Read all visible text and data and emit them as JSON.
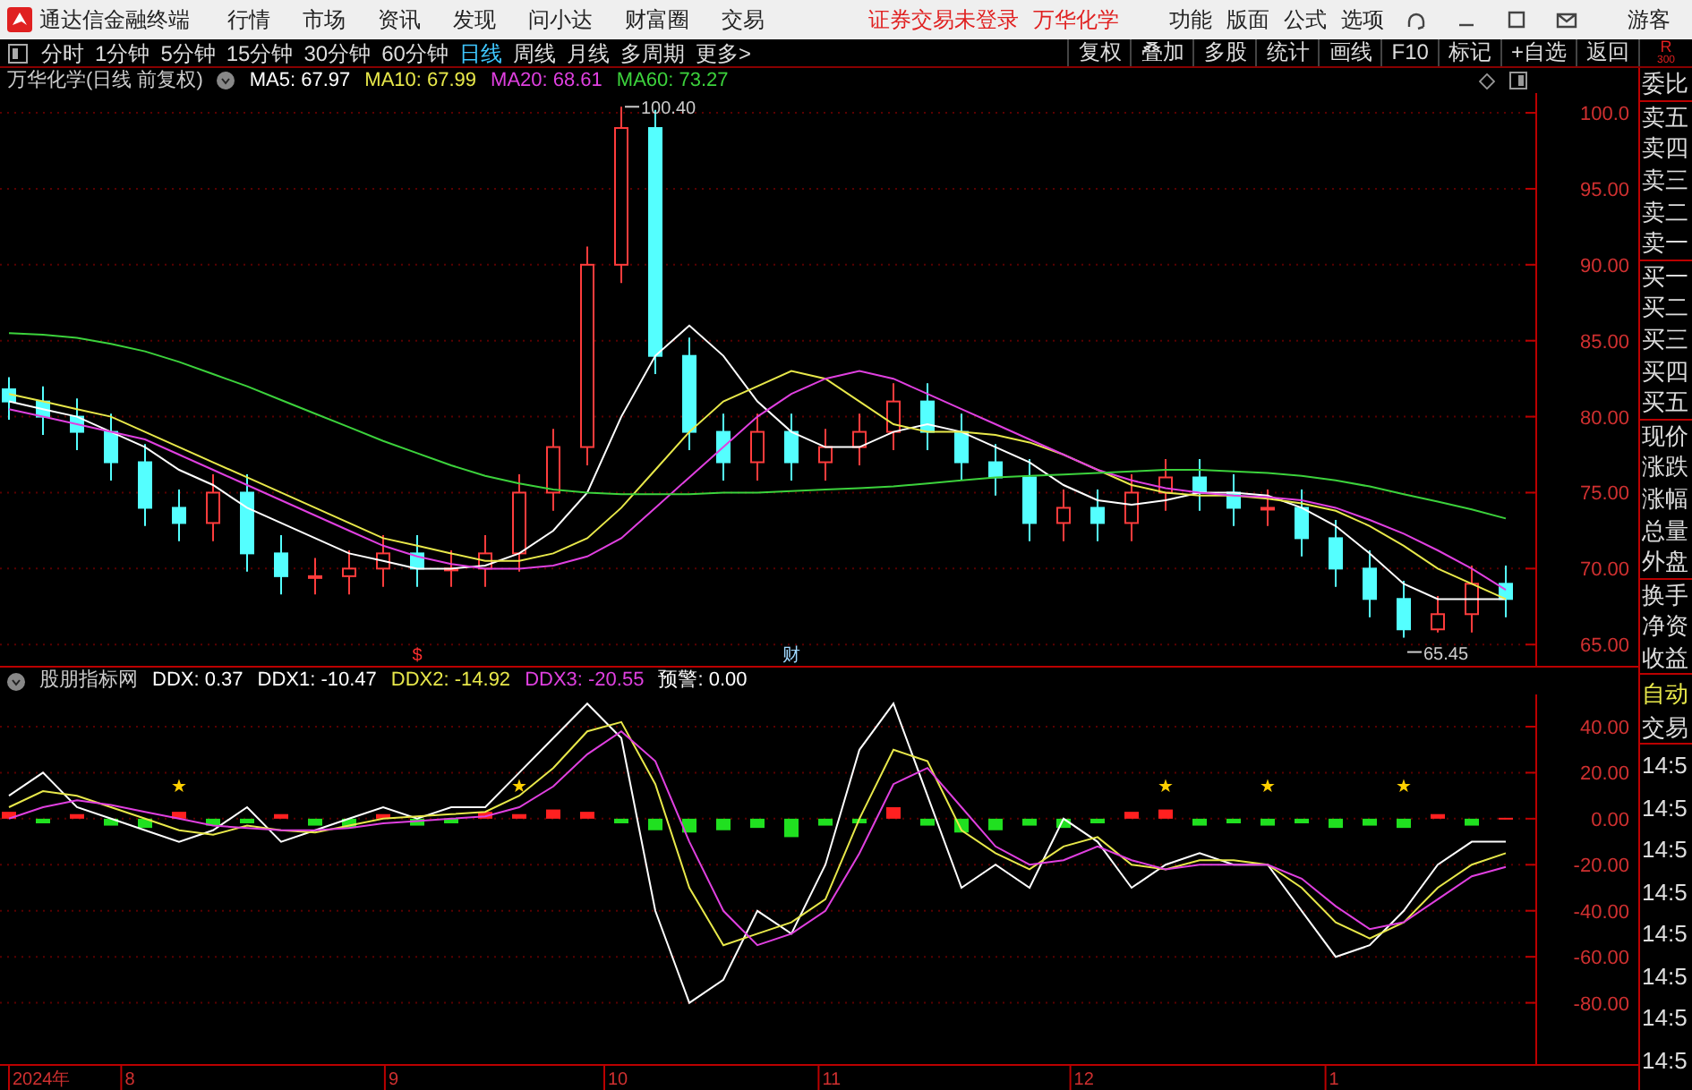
{
  "app_bar": {
    "title": "通达信金融终端",
    "menu": [
      "行情",
      "市场",
      "资讯",
      "发现",
      "问小达",
      "财富圈",
      "交易"
    ],
    "notices": [
      "证券交易未登录",
      "万华化学"
    ],
    "actions": [
      "功能",
      "版面",
      "公式",
      "选项"
    ],
    "user": "游客"
  },
  "toolbar": {
    "periods": [
      {
        "label": "分时",
        "selected": false
      },
      {
        "label": "1分钟",
        "selected": false
      },
      {
        "label": "5分钟",
        "selected": false
      },
      {
        "label": "15分钟",
        "selected": false
      },
      {
        "label": "30分钟",
        "selected": false
      },
      {
        "label": "60分钟",
        "selected": false
      },
      {
        "label": "日线",
        "selected": true
      },
      {
        "label": "周线",
        "selected": false
      },
      {
        "label": "月线",
        "selected": false
      },
      {
        "label": "多周期",
        "selected": false
      },
      {
        "label": "更多>",
        "selected": false
      }
    ],
    "tools": [
      "复权",
      "叠加",
      "多股",
      "统计",
      "画线",
      "F10",
      "标记",
      "+自选",
      "返回"
    ],
    "corner": [
      "R",
      "300"
    ]
  },
  "price_panel": {
    "title": "万华化学(日线 前复权)",
    "legend": [
      {
        "text": "MA5: 67.97",
        "color": "#ffffff"
      },
      {
        "text": "MA10: 67.99",
        "color": "#e8e84a"
      },
      {
        "text": "MA20: 68.61",
        "color": "#e040e0"
      },
      {
        "text": "MA60: 73.27",
        "color": "#3cd23c"
      }
    ],
    "chart_data": {
      "type": "candlestick",
      "grid": true,
      "ylim": [
        63.6,
        101.3
      ],
      "yticks": [
        {
          "value": 100,
          "label": "100.0"
        },
        {
          "value": 95,
          "label": "95.00"
        },
        {
          "value": 90,
          "label": "90.00"
        },
        {
          "value": 85,
          "label": "85.00"
        },
        {
          "value": 80,
          "label": "80.00"
        },
        {
          "value": 75,
          "label": "75.00"
        },
        {
          "value": 70,
          "label": "70.00"
        },
        {
          "value": 65,
          "label": "65.00"
        }
      ],
      "ohlc": [
        [
          81.8,
          82.6,
          79.8,
          81
        ],
        [
          81,
          82,
          78.8,
          80
        ],
        [
          80,
          81.2,
          77.8,
          79
        ],
        [
          79,
          80.2,
          75.8,
          77
        ],
        [
          77,
          78.2,
          72.8,
          74
        ],
        [
          74,
          75.2,
          71.8,
          73
        ],
        [
          73,
          76.2,
          71.8,
          75
        ],
        [
          75,
          76.2,
          69.8,
          71
        ],
        [
          71,
          72.2,
          68.3,
          69.5
        ],
        [
          69.5,
          70.7,
          68.3,
          69.5
        ],
        [
          69.5,
          71.2,
          68.3,
          70
        ],
        [
          70,
          72.2,
          68.8,
          71
        ],
        [
          71,
          72.2,
          68.8,
          70
        ],
        [
          70,
          71.2,
          68.8,
          70
        ],
        [
          70,
          72.2,
          68.8,
          71
        ],
        [
          71,
          76.2,
          69.8,
          75
        ],
        [
          75,
          79.2,
          73.8,
          78
        ],
        [
          78,
          91.2,
          76.8,
          90
        ],
        [
          90,
          100.4,
          88.8,
          99
        ],
        [
          99,
          100.2,
          82.8,
          84
        ],
        [
          84,
          85.2,
          77.8,
          79
        ],
        [
          79,
          80.2,
          75.8,
          77
        ],
        [
          77,
          80.2,
          75.8,
          79
        ],
        [
          79,
          80.2,
          75.8,
          77
        ],
        [
          77,
          79.2,
          75.8,
          78
        ],
        [
          78,
          80.2,
          76.8,
          79
        ],
        [
          79,
          82.2,
          77.8,
          81
        ],
        [
          81,
          82.2,
          77.8,
          79
        ],
        [
          79,
          80.2,
          75.8,
          77
        ],
        [
          77,
          78.2,
          74.8,
          76
        ],
        [
          76,
          77.2,
          71.8,
          73
        ],
        [
          73,
          75.2,
          71.8,
          74
        ],
        [
          74,
          75.2,
          71.8,
          73
        ],
        [
          73,
          76.2,
          71.8,
          75
        ],
        [
          75,
          77.2,
          73.8,
          76
        ],
        [
          76,
          77.2,
          73.8,
          75
        ],
        [
          75,
          76.2,
          72.8,
          74
        ],
        [
          74,
          75.2,
          72.8,
          74
        ],
        [
          74,
          75.2,
          70.8,
          72
        ],
        [
          72,
          73.2,
          68.8,
          70
        ],
        [
          70,
          71.2,
          66.8,
          68
        ],
        [
          68,
          69.2,
          65.45,
          66
        ],
        [
          66,
          68.2,
          65.8,
          67
        ],
        [
          67,
          70.2,
          65.8,
          69
        ],
        [
          69,
          70.2,
          66.8,
          68
        ]
      ],
      "annotations": [
        "100.40",
        "65.45"
      ]
    },
    "moving_averages": {
      "chart_data": {
        "type": "line",
        "ylim": [
          63.6,
          101.3
        ],
        "series": [
          {
            "color": "#ffffff",
            "values": [
              81,
              80.5,
              80,
              79,
              78,
              76.5,
              75.5,
              74,
              73,
              72,
              71,
              70.5,
              70,
              70,
              70.2,
              71,
              72.5,
              75,
              80,
              84,
              86,
              84,
              81,
              79,
              78,
              78,
              79,
              79.5,
              79,
              78,
              77,
              75.5,
              74.5,
              74.2,
              74.5,
              75,
              75,
              74.8,
              74,
              72.8,
              71,
              69,
              68,
              68,
              68
            ]
          },
          {
            "color": "#e8e84a",
            "values": [
              81.5,
              81,
              80.5,
              80,
              79,
              78,
              77,
              76,
              75,
              74,
              73,
              72,
              71.5,
              71,
              70.5,
              70.5,
              71,
              72,
              74,
              76.5,
              79,
              81,
              82,
              83,
              82.5,
              81,
              79.5,
              79,
              79,
              78.8,
              78.3,
              77.5,
              76.5,
              75.5,
              75,
              74.8,
              74.8,
              74.6,
              74.3,
              73.8,
              72.8,
              71.5,
              70,
              69,
              68
            ]
          },
          {
            "color": "#e040e0",
            "values": [
              80.5,
              80,
              79.5,
              79,
              78.5,
              77.5,
              76.5,
              75.5,
              74.5,
              73.5,
              72.5,
              71.5,
              70.8,
              70.3,
              70,
              70,
              70.2,
              70.8,
              72,
              74,
              76,
              78,
              80,
              81.5,
              82.5,
              83,
              82.5,
              81.5,
              80.5,
              79.5,
              78.5,
              77.5,
              76.5,
              75.8,
              75.3,
              75,
              74.8,
              74.7,
              74.5,
              74,
              73.2,
              72.3,
              71.2,
              70,
              68.6
            ]
          },
          {
            "color": "#3cd23c",
            "values": [
              85.5,
              85.4,
              85.2,
              84.8,
              84.3,
              83.6,
              82.8,
              82,
              81.1,
              80.2,
              79.3,
              78.4,
              77.6,
              76.8,
              76.1,
              75.6,
              75.2,
              75,
              74.9,
              74.9,
              74.9,
              75,
              75,
              75.1,
              75.2,
              75.3,
              75.4,
              75.6,
              75.8,
              76,
              76.1,
              76.2,
              76.3,
              76.4,
              76.5,
              76.5,
              76.4,
              76.3,
              76.1,
              75.8,
              75.4,
              74.9,
              74.4,
              73.9,
              73.3
            ]
          }
        ]
      }
    },
    "event_markers": [
      {
        "text": "$",
        "color": "#ff3030"
      },
      {
        "text": "财",
        "color": "#a0d8ff"
      }
    ]
  },
  "indicator_panel": {
    "title": "股朋指标网",
    "legend": [
      {
        "text": "DDX: 0.37",
        "color": "#ffffff"
      },
      {
        "text": "DDX1: -10.47",
        "color": "#ffffff"
      },
      {
        "text": "DDX2: -14.92",
        "color": "#e8e84a"
      },
      {
        "text": "DDX3: -20.55",
        "color": "#e040e0"
      },
      {
        "text": "预警: 0.00",
        "color": "#ffffff"
      }
    ],
    "chart_data": {
      "type": "bar",
      "grid": true,
      "ylim": [
        -107,
        54
      ],
      "yticks": [
        {
          "value": 40,
          "label": "40.00"
        },
        {
          "value": 20,
          "label": "20.00"
        },
        {
          "value": 0,
          "label": "0.00"
        },
        {
          "value": -20,
          "label": "-20.00"
        },
        {
          "value": -40,
          "label": "-40.00"
        },
        {
          "value": -60,
          "label": "-60.00"
        },
        {
          "value": -80,
          "label": "-80.00"
        }
      ],
      "values": [
        3,
        -2,
        2,
        -3,
        -4,
        3,
        -3,
        -2,
        2,
        -3,
        -4,
        2,
        -3,
        -2,
        3,
        2,
        4,
        3,
        -2,
        -5,
        -6,
        -5,
        -4,
        -8,
        -3,
        -2,
        5,
        -3,
        -6,
        -5,
        -3,
        -4,
        -2,
        3,
        4,
        -3,
        -2,
        -3,
        -2,
        -4,
        -3,
        -4,
        2,
        -3,
        0.4
      ]
    },
    "lines": {
      "chart_data": {
        "type": "line",
        "ylim": [
          -107,
          54
        ],
        "series": [
          {
            "color": "#ffffff",
            "values": [
              10,
              20,
              5,
              0,
              -5,
              -10,
              -5,
              5,
              -10,
              -5,
              0,
              5,
              0,
              5,
              5,
              20,
              35,
              50,
              35,
              -40,
              -80,
              -70,
              -40,
              -50,
              -20,
              30,
              50,
              10,
              -30,
              -20,
              -30,
              0,
              -10,
              -30,
              -20,
              -15,
              -20,
              -20,
              -40,
              -60,
              -55,
              -40,
              -20,
              -10,
              -10
            ]
          },
          {
            "color": "#e8e84a",
            "values": [
              5,
              12,
              10,
              5,
              0,
              -5,
              -7,
              -3,
              -5,
              -6,
              -3,
              0,
              1,
              2,
              3,
              10,
              22,
              38,
              42,
              15,
              -30,
              -55,
              -50,
              -45,
              -35,
              0,
              30,
              25,
              -5,
              -15,
              -22,
              -12,
              -8,
              -20,
              -22,
              -18,
              -18,
              -20,
              -30,
              -45,
              -52,
              -45,
              -30,
              -20,
              -15
            ]
          },
          {
            "color": "#e040e0",
            "values": [
              0,
              5,
              8,
              6,
              3,
              0,
              -3,
              -4,
              -5,
              -5,
              -4,
              -2,
              -1,
              0,
              1,
              5,
              14,
              28,
              38,
              25,
              -10,
              -40,
              -55,
              -50,
              -40,
              -15,
              15,
              22,
              5,
              -12,
              -20,
              -18,
              -12,
              -18,
              -22,
              -20,
              -20,
              -20,
              -26,
              -38,
              -48,
              -45,
              -35,
              -25,
              -21
            ]
          }
        ]
      }
    },
    "signal_stars": [
      "★",
      "★",
      "★",
      "★",
      "★"
    ]
  },
  "date_axis": [
    "2024年",
    "8",
    "9",
    "10",
    "11",
    "12",
    "1"
  ],
  "quote_sidebar": {
    "sections": [
      {
        "items": [
          {
            "label": "委比"
          }
        ]
      },
      {
        "items": [
          {
            "label": "卖五"
          },
          {
            "label": "卖四"
          },
          {
            "label": "卖三"
          },
          {
            "label": "卖二"
          },
          {
            "label": "卖一"
          }
        ]
      },
      {
        "items": [
          {
            "label": "买一"
          },
          {
            "label": "买二"
          },
          {
            "label": "买三"
          },
          {
            "label": "买四"
          },
          {
            "label": "买五"
          }
        ]
      },
      {
        "items": [
          {
            "label": "现价"
          },
          {
            "label": "涨跌"
          },
          {
            "label": "涨幅"
          },
          {
            "label": "总量"
          },
          {
            "label": "外盘"
          }
        ]
      },
      {
        "items": [
          {
            "label": "换手"
          },
          {
            "label": "净资"
          },
          {
            "label": "收益"
          }
        ]
      },
      {
        "items": [
          {
            "label": "自动",
            "kind": "toggle"
          },
          {
            "label": "交易"
          }
        ]
      }
    ],
    "times": [
      "14:5",
      "14:5",
      "14:5",
      "14:5",
      "14:5",
      "14:5",
      "14:5",
      "14:5"
    ]
  }
}
